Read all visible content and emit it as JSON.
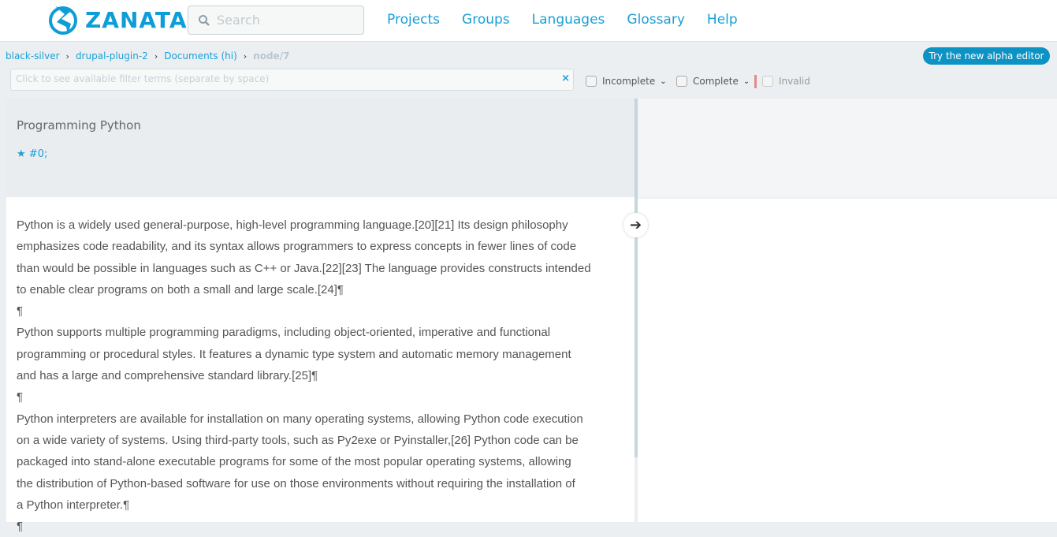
{
  "header": {
    "logo": "ZANATA",
    "search_placeholder": "Search",
    "nav": [
      "Projects",
      "Groups",
      "Languages",
      "Glossary",
      "Help"
    ]
  },
  "breadcrumbs": [
    "black-silver",
    "drupal-plugin-2",
    "Documents (hi)"
  ],
  "breadcrumb_current": "node/7",
  "alpha_button": "Try the new alpha editor",
  "filter": {
    "placeholder": "Click to see available filter terms (separate by space)",
    "clear": "×"
  },
  "filters": {
    "incomplete": "Incomplete",
    "complete": "Complete",
    "invalid": "Invalid"
  },
  "source": {
    "title": "Programming Python",
    "ref": "#0;"
  },
  "body_lines": [
    "Python is a widely used general-purpose, high-level programming language.[20][21] Its design philosophy",
    "emphasizes code readability, and its syntax allows programmers to express concepts in fewer lines of code",
    "than would be possible in languages such as C++ or Java.[22][23] The language provides constructs intended",
    "to enable clear programs on both a small and large scale.[24]¶",
    "¶",
    "Python supports multiple programming paradigms, including object-oriented, imperative and functional",
    "programming or procedural styles. It features a dynamic type system and automatic memory management",
    "and has a large and comprehensive standard library.[25]¶",
    "¶",
    "Python interpreters are available for installation on many operating systems, allowing Python code execution",
    "on a wide variety of systems. Using third-party tools, such as Py2exe or Pyinstaller,[26] Python code can be",
    "packaged into stand-alone executable programs for some of the most popular operating systems, allowing",
    "the distribution of Python-based software for use on those environments without requiring the installation of",
    "a Python interpreter.¶",
    "¶"
  ]
}
